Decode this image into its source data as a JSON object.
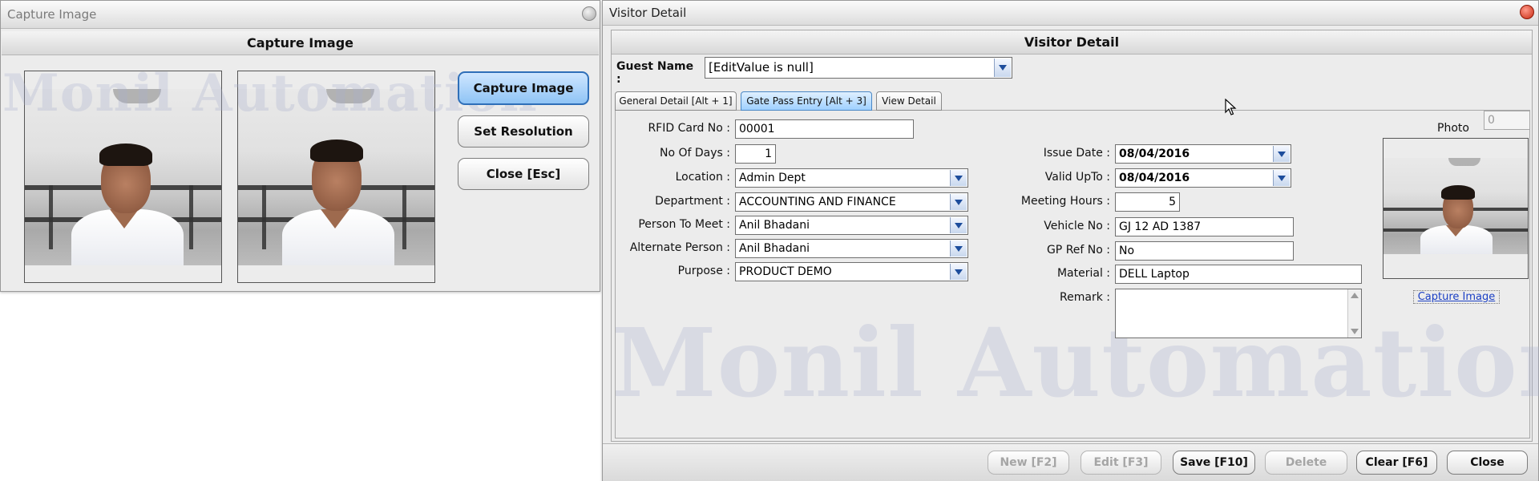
{
  "capture_window": {
    "title": "Capture Image",
    "header": "Capture Image",
    "watermark": "Monil Automation",
    "buttons": {
      "capture": "Capture Image",
      "resolution": "Set Resolution",
      "close": "Close [Esc]"
    }
  },
  "visitor_window": {
    "title": "Visitor Detail",
    "header": "Visitor Detail",
    "watermark": "Monil Automation",
    "guest": {
      "label": "Guest Name :",
      "value": "[EditValue is null]"
    },
    "tabs": [
      {
        "label": "General Detail [Alt + 1]",
        "active": false
      },
      {
        "label": "Gate Pass Entry [Alt + 3]",
        "active": true
      },
      {
        "label": "View Detail",
        "active": false
      }
    ],
    "counter": "0",
    "left_fields": {
      "rfid": {
        "label": "RFID Card No :",
        "value": "00001"
      },
      "days": {
        "label": "No Of Days :",
        "value": "1"
      },
      "location": {
        "label": "Location :",
        "value": "Admin Dept"
      },
      "department": {
        "label": "Department :",
        "value": "ACCOUNTING AND FINANCE"
      },
      "person": {
        "label": "Person To Meet :",
        "value": "Anil Bhadani"
      },
      "alternate": {
        "label": "Alternate Person :",
        "value": "Anil Bhadani"
      },
      "purpose": {
        "label": "Purpose :",
        "value": "PRODUCT DEMO"
      }
    },
    "right_fields": {
      "issue_date": {
        "label": "Issue Date :",
        "value": "08/04/2016"
      },
      "valid_upto": {
        "label": "Valid UpTo :",
        "value": "08/04/2016"
      },
      "meeting_hours": {
        "label": "Meeting Hours :",
        "value": "5"
      },
      "vehicle": {
        "label": "Vehicle No :",
        "value": "GJ 12 AD 1387"
      },
      "gp_ref": {
        "label": "GP Ref No :",
        "value": "No"
      },
      "material": {
        "label": "Material :",
        "value": "DELL Laptop"
      },
      "remark": {
        "label": "Remark :",
        "value": ""
      }
    },
    "photo": {
      "label": "Photo",
      "capture_link": "Capture Image"
    },
    "footer_buttons": {
      "new": "New [F2]",
      "edit": "Edit [F3]",
      "save": "Save [F10]",
      "delete": "Delete",
      "clear": "Clear [F6]",
      "close": "Close"
    }
  },
  "colors": {
    "primary_button": "#8fc4f5",
    "active_tab": "#9fd0ff",
    "link": "#1a3fc4",
    "watermark": "#aaafcd"
  }
}
